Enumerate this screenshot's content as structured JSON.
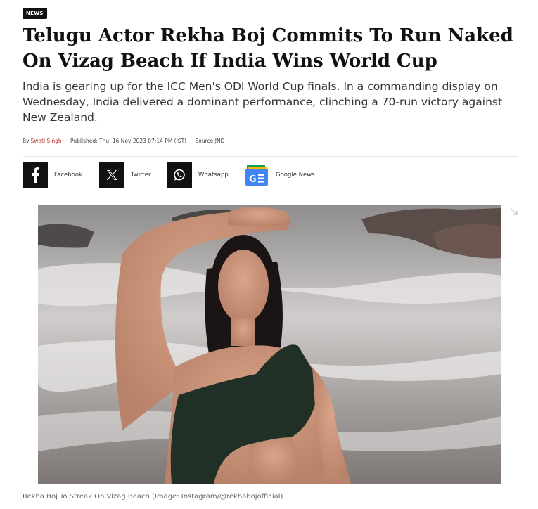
{
  "article": {
    "category": "NEWS",
    "headline": "Telugu Actor Rekha Boj Commits To Run Naked On Vizag Beach If India Wins World Cup",
    "summary": "India is gearing up for the ICC Men's ODI World Cup finals. In a commanding display on Wednesday, India delivered a dominant performance, clinching a 70-run victory against New Zealand.",
    "byline_prefix": "By",
    "author": "Swati Singh",
    "published": "Published: Thu, 16 Nov 2023 07:14 PM (IST)",
    "source": "Source:JND"
  },
  "share": [
    {
      "label": "Facebook",
      "icon": "facebook-icon"
    },
    {
      "label": "Twitter",
      "icon": "x-twitter-icon"
    },
    {
      "label": "Whatsapp",
      "icon": "whatsapp-icon"
    },
    {
      "label": "Google News",
      "icon": "google-news-icon"
    }
  ],
  "image": {
    "caption": "Rekha Boj To Streak On Vizag Beach (Image: Instagram/@rekhabojofficial)"
  },
  "colors": {
    "author": "#c0392b",
    "icon_bg": "#111111",
    "badge_bg": "#111111"
  }
}
